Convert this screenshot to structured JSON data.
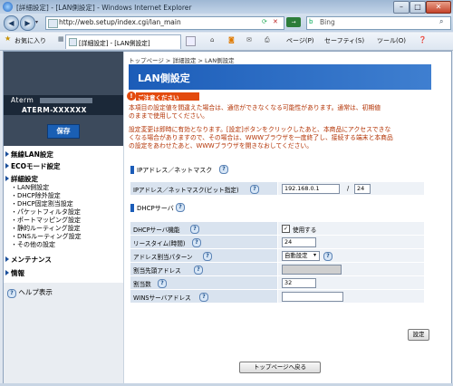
{
  "window": {
    "title": "[詳細設定] - [LAN側設定] - Windows Internet Explorer"
  },
  "address_bar": {
    "url": "http://web.setup/index.cgi/lan_main",
    "search_placeholder": "Bing"
  },
  "favorites_bar": {
    "favorites_label": "お気に入り",
    "tab_label": "[詳細設定] - [LAN側設定]",
    "page_menu": "ページ(P)",
    "safety_menu": "セーフティ(S)",
    "tools_menu": "ツール(O)"
  },
  "sidebar": {
    "brand_line1": "Aterm",
    "brand_line2": "ATERM-XXXXXX",
    "save_label": "保存",
    "menu": [
      {
        "label": "無線LAN設定",
        "level": "main"
      },
      {
        "label": "ECOモード設定",
        "level": "main"
      },
      {
        "label": "詳細設定",
        "level": "main"
      },
      {
        "label": "LAN側設定",
        "level": "sub"
      },
      {
        "label": "DHCP除外設定",
        "level": "sub"
      },
      {
        "label": "DHCP固定割当設定",
        "level": "sub"
      },
      {
        "label": "パケットフィルタ設定",
        "level": "sub"
      },
      {
        "label": "ポートマッピング設定",
        "level": "sub"
      },
      {
        "label": "静的ルーティング設定",
        "level": "sub"
      },
      {
        "label": "DNSルーティング設定",
        "level": "sub"
      },
      {
        "label": "その他の設定",
        "level": "sub"
      },
      {
        "label": "メンテナンス",
        "level": "main"
      },
      {
        "label": "情報",
        "level": "main"
      }
    ],
    "help_label": "ヘルプ表示"
  },
  "main": {
    "breadcrumb": "トップページ > 詳細設定 > LAN側設定",
    "page_title": "LAN側設定",
    "caution_label": "ご注意ください",
    "caution_text": [
      "本項目の設定値を間違えた場合は、通信ができなくなる可能性があります。通常は、初期値",
      "のままで使用してください。"
    ],
    "note_text": [
      "設定変更は即時に有効となります。[設定]ボタンをクリックしたあと、本商品にアクセスできな",
      "くなる場合がありますので、その場合は、WWWブラウザを一度終了し、接続する端末と本商品",
      "の設定をあわせたあと、WWWブラウザを開きなおしてください。"
    ],
    "section_ip": {
      "heading": "IPアドレス／ネットマスク",
      "label": "IPアドレス／ネットマスク(ビット指定)",
      "ip_value": "192.168.0.1",
      "separator": "/",
      "mask_value": "24"
    },
    "section_dhcp": {
      "heading": "DHCPサーバ",
      "rows": {
        "dhcp_server": {
          "label": "DHCPサーバ機能",
          "check_label": "使用する",
          "checked": true
        },
        "lease_time": {
          "label": "リースタイム(時間)",
          "value": "24"
        },
        "alloc_pattern": {
          "label": "アドレス割当パターン",
          "value": "自動設定"
        },
        "alloc_start": {
          "label": "割当先頭アドレス",
          "value": ""
        },
        "alloc_count": {
          "label": "割当数",
          "value": "32"
        },
        "wins": {
          "label": "WINSサーバアドレス",
          "value": ""
        }
      }
    },
    "apply_label": "設定",
    "back_label": "トップページへ戻る"
  },
  "colors": {
    "title_blue": "#1b5cb8",
    "caution_red": "#e34a0e",
    "warn_text": "#b23000",
    "sidebar_dark": "#3c4a5c"
  }
}
